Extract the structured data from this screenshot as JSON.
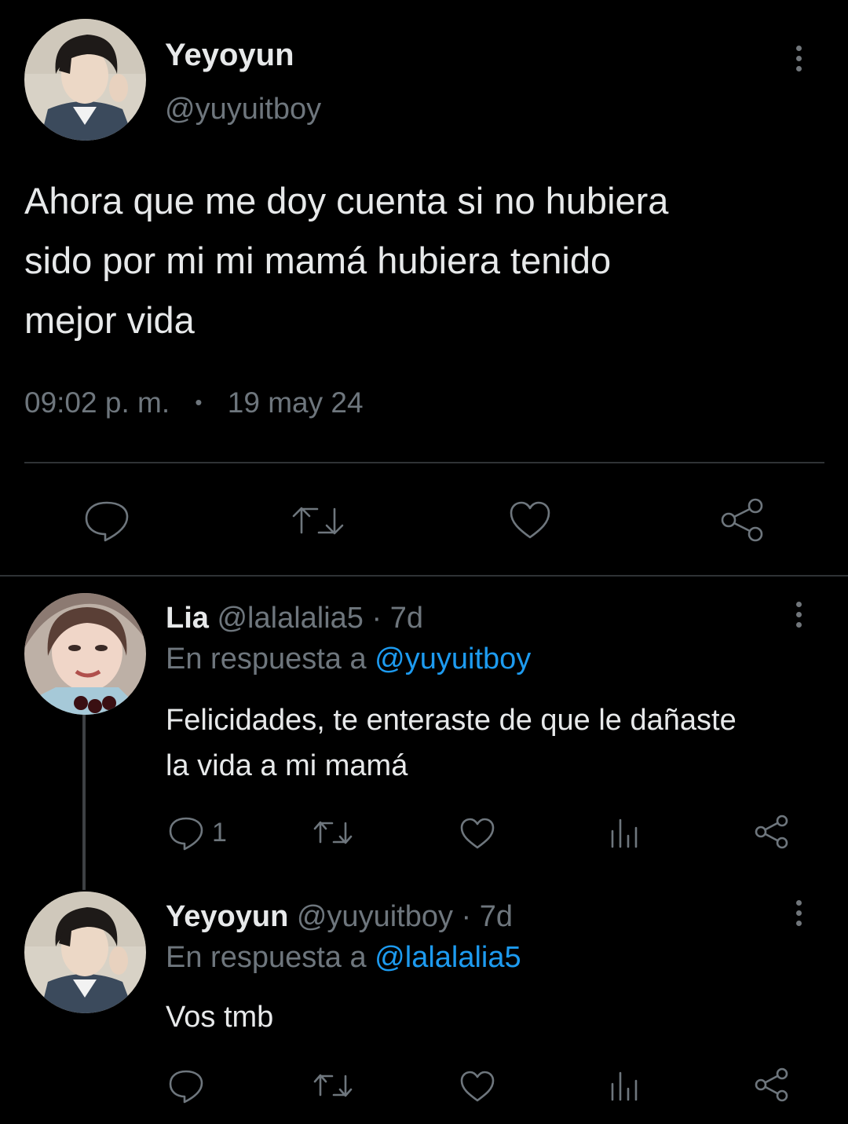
{
  "main_tweet": {
    "display_name": "Yeyoyun",
    "handle": "@yuyuitboy",
    "text_lines": [
      "Ahora que me doy cuenta si no hubiera",
      "sido por mi mi mamá hubiera tenido",
      "mejor vida"
    ],
    "time": "09:02 p. m.",
    "separator": "•",
    "date": "19 may 24"
  },
  "replies": [
    {
      "display_name": "Lia",
      "handle": "@lalalalia5",
      "age": "· 7d",
      "reply_prefix": "En respuesta a",
      "reply_to": "@yuyuitboy",
      "text_lines": [
        "Felicidades, te enteraste de que le dañaste",
        "la vida a mi mamá"
      ],
      "reply_count": "1"
    },
    {
      "display_name": "Yeyoyun",
      "handle": "@yuyuitboy",
      "age": "· 7d",
      "reply_prefix": "En respuesta a",
      "reply_to": "@lalalalia5",
      "text_lines": [
        "Vos tmb"
      ],
      "reply_count": ""
    }
  ],
  "colors": {
    "background": "#000000",
    "text": "#e7e9ea",
    "muted": "#6e767d",
    "link": "#1d9bf0",
    "divider": "#2f3336"
  }
}
